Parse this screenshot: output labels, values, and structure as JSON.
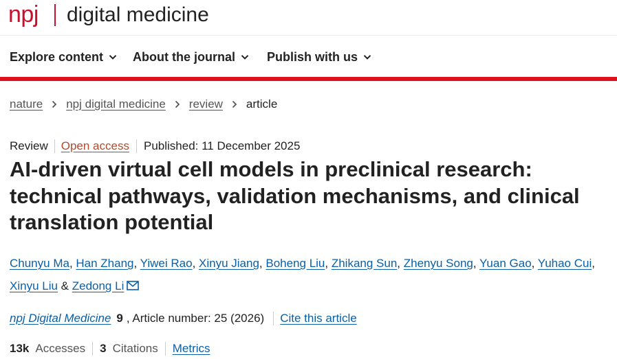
{
  "brand": {
    "logo_text": "npj",
    "journal_title": "digital medicine",
    "color": "#c8102e"
  },
  "nav": {
    "items": [
      {
        "label": "Explore content"
      },
      {
        "label": "About the journal"
      },
      {
        "label": "Publish with us"
      }
    ],
    "accent_rule_color": "#e0101c"
  },
  "breadcrumb": {
    "items": [
      "nature",
      "npj digital medicine",
      "review"
    ],
    "current": "article"
  },
  "article": {
    "type": "Review",
    "access": "Open access",
    "published": "Published: 11 December 2025",
    "title": "AI-driven virtual cell models in preclinical research: technical pathways, validation mechanisms, and clinical translation potential",
    "authors": [
      "Chunyu Ma",
      "Han Zhang",
      "Yiwei Rao",
      "Xinyu Jiang",
      "Boheng Liu",
      "Zhikang Sun",
      "Zhenyu Song",
      "Yuan Gao",
      "Yuhao Cui",
      "Xinyu Liu",
      "Zedong Li"
    ],
    "author_separator": ", ",
    "last_author_joiner": " & ",
    "corresponding_icon": "envelope-icon",
    "journal": "npj Digital Medicine",
    "volume": "9",
    "article_number": ", Article number: 25 (2026)",
    "cite_label": "Cite this article"
  },
  "metrics": {
    "accesses_count": "13k",
    "accesses_label": "Accesses",
    "citations_count": "3",
    "citations_label": "Citations",
    "metrics_link": "Metrics"
  },
  "colors": {
    "link": "#0b5fa5",
    "open_access": "#b34a2c"
  }
}
